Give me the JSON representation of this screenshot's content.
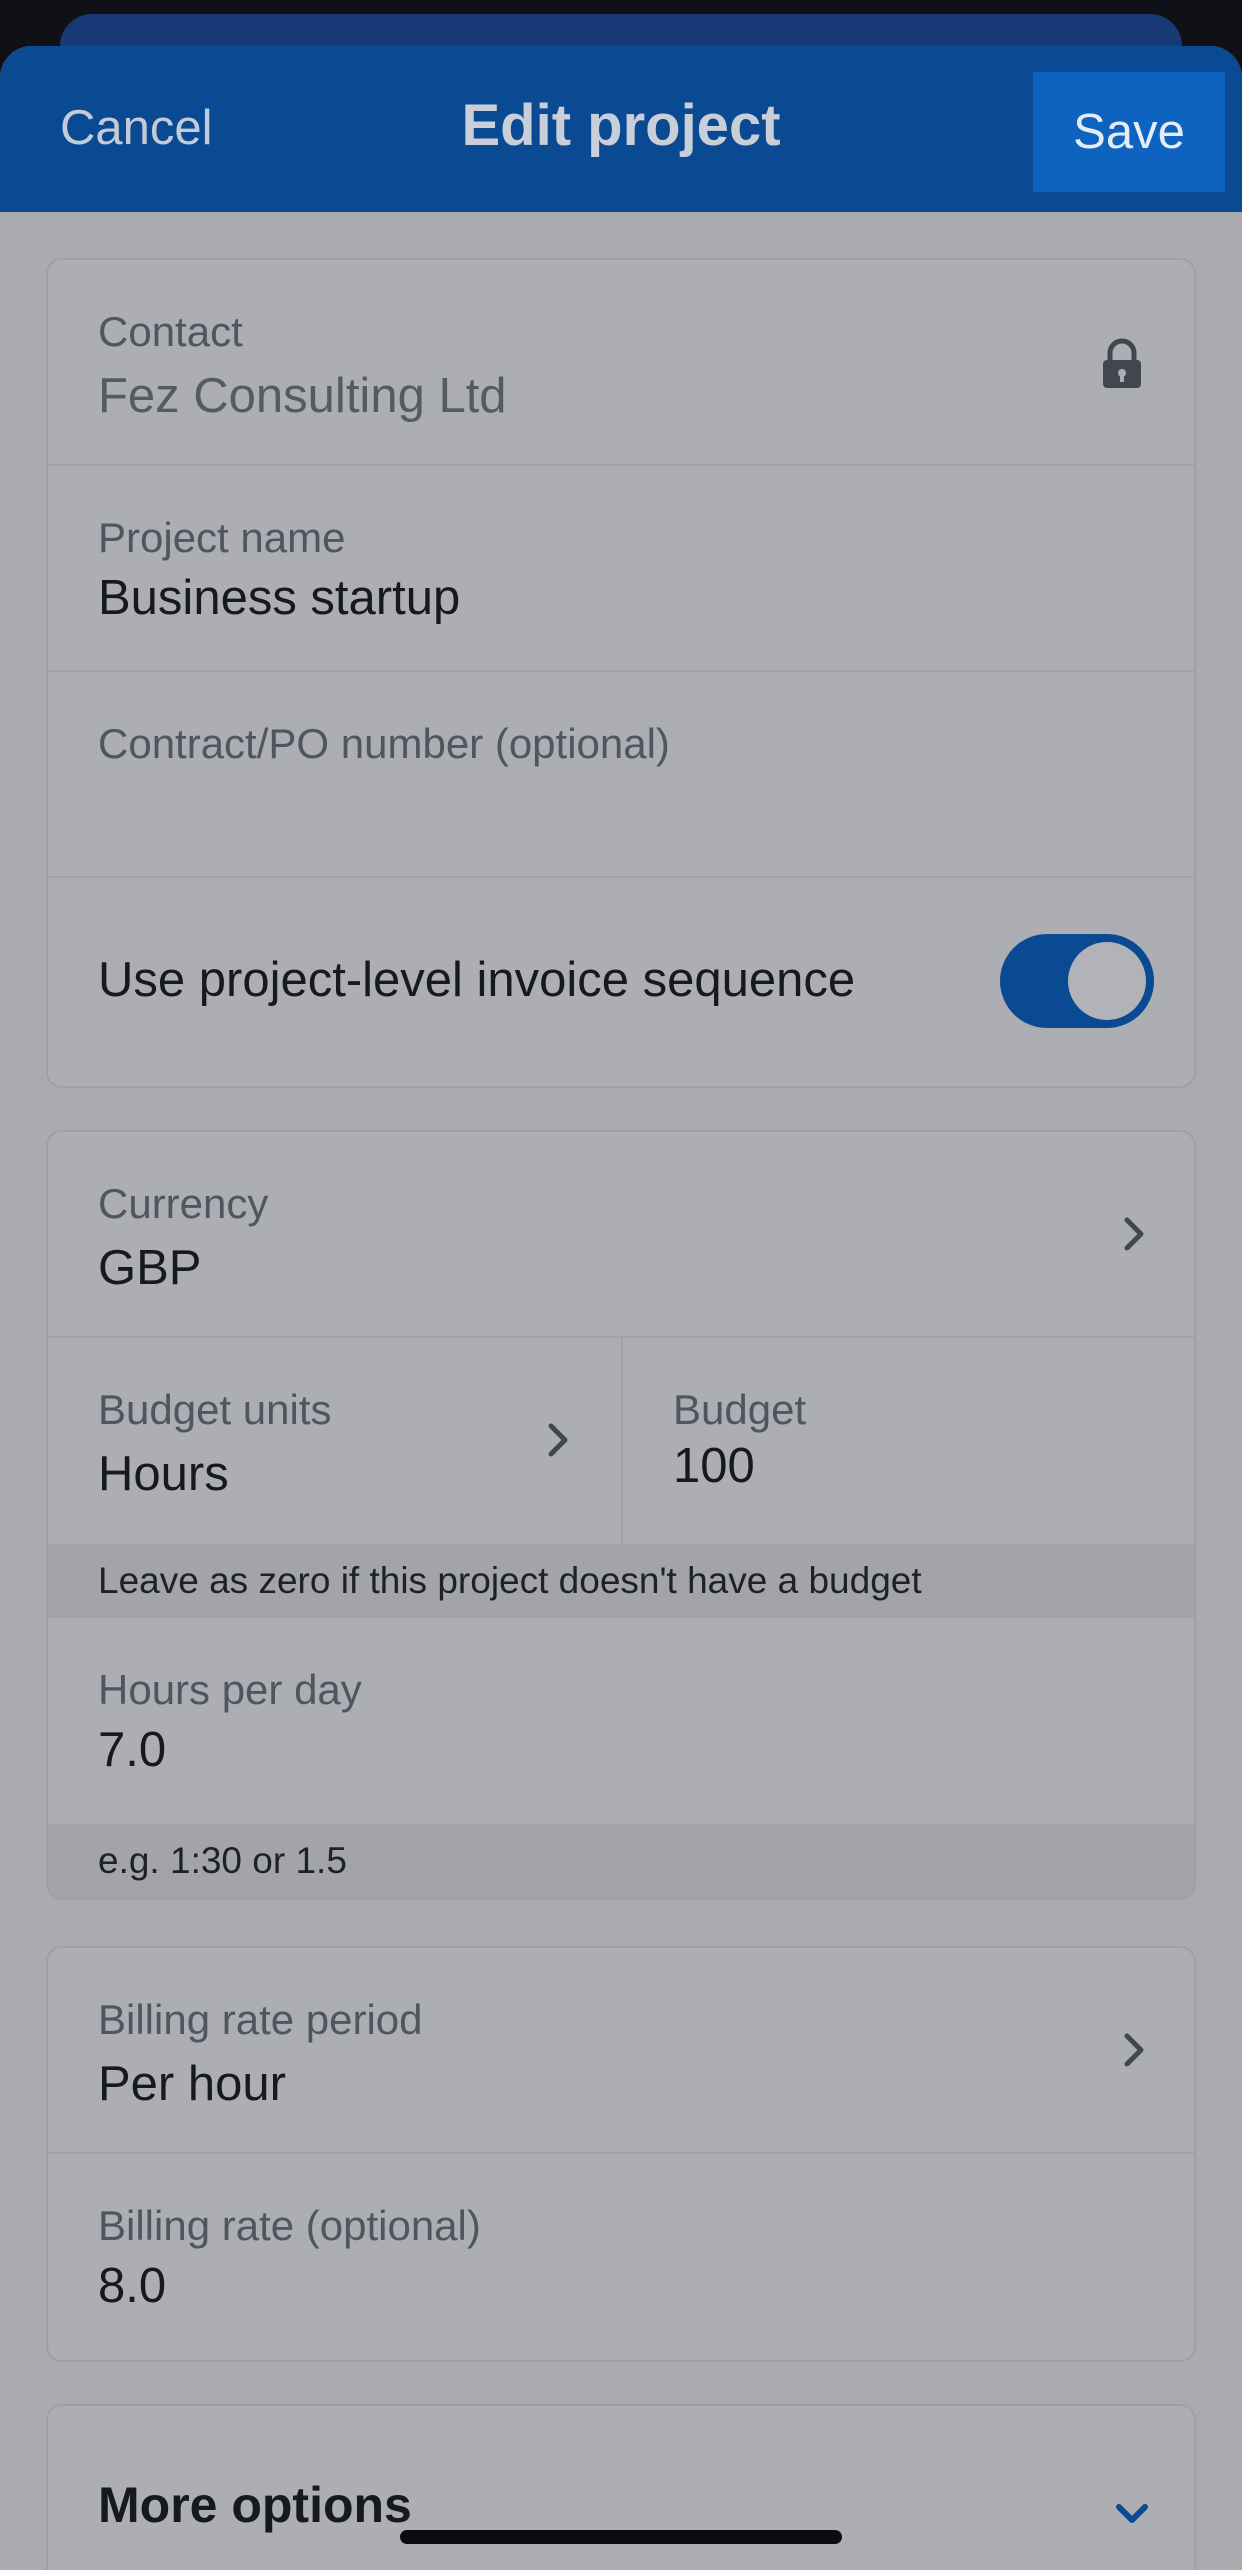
{
  "header": {
    "cancel_label": "Cancel",
    "title": "Edit project",
    "save_label": "Save"
  },
  "details": {
    "contact_label": "Contact",
    "contact_value": "Fez Consulting Ltd",
    "project_name_label": "Project name",
    "project_name_value": "Business startup",
    "contract_label": "Contract/PO number (optional)",
    "contract_value": "",
    "invoice_sequence_label": "Use project-level invoice sequence",
    "invoice_sequence_on": true
  },
  "budget": {
    "currency_label": "Currency",
    "currency_value": "GBP",
    "budget_units_label": "Budget units",
    "budget_units_value": "Hours",
    "budget_label": "Budget",
    "budget_value": "100",
    "budget_hint": "Leave as zero if this project doesn't have a budget",
    "hours_per_day_label": "Hours per day",
    "hours_per_day_value": "7.0",
    "hours_hint": "e.g. 1:30 or 1.5"
  },
  "billing": {
    "rate_period_label": "Billing rate period",
    "rate_period_value": "Per hour",
    "rate_label": "Billing rate (optional)",
    "rate_value": "8.0"
  },
  "more_options": {
    "label": "More options"
  },
  "colors": {
    "header_bg": "#0a4a92",
    "save_bg": "#0d63bf",
    "toggle_on": "#0a4a92",
    "sheet_bg": "#a9abb1"
  },
  "icons": {
    "contact_lock": "lock-icon",
    "row_chevron": "chevron-right-icon",
    "more_chevron": "chevron-down-icon"
  }
}
